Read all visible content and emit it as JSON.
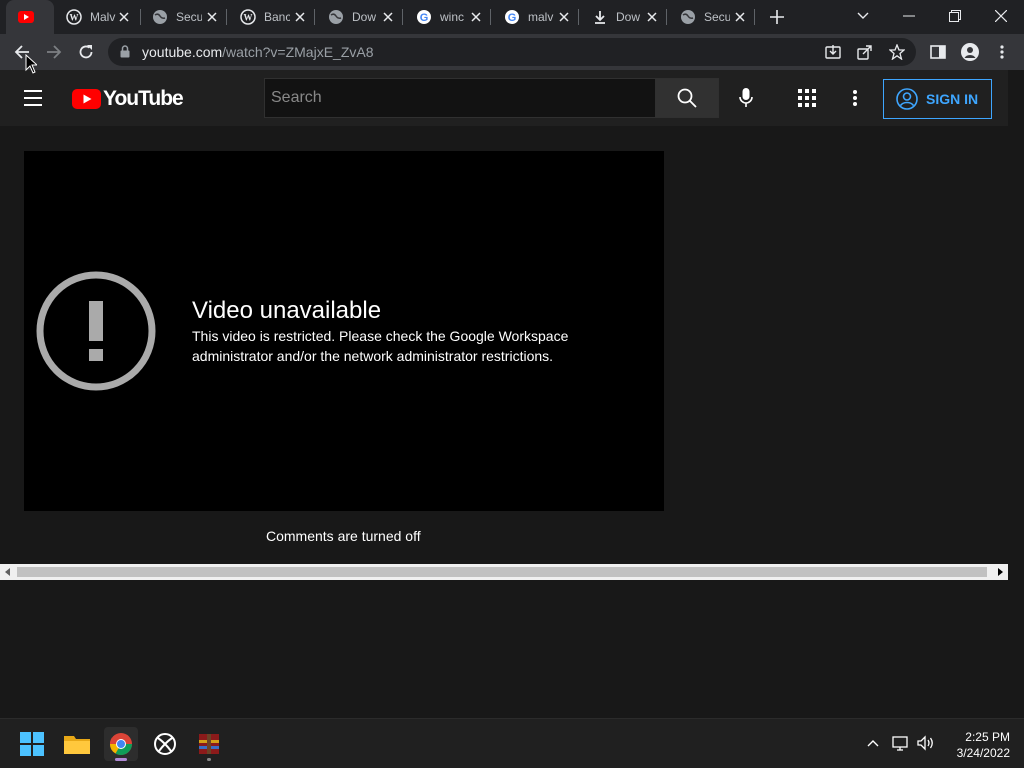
{
  "browser": {
    "tabs": [
      {
        "label": "",
        "favicon": "youtube-icon",
        "active": true
      },
      {
        "label": "Malv",
        "favicon": "wordpress-icon"
      },
      {
        "label": "Secu",
        "favicon": "globe-icon"
      },
      {
        "label": "Banc",
        "favicon": "wordpress-icon"
      },
      {
        "label": "Dow",
        "favicon": "globe-icon"
      },
      {
        "label": "winc",
        "favicon": "google-icon"
      },
      {
        "label": "malv",
        "favicon": "google-icon"
      },
      {
        "label": "Dow",
        "favicon": "download-icon"
      },
      {
        "label": "Secu",
        "favicon": "globe-icon"
      }
    ],
    "url_host": "youtube.com",
    "url_path": "/watch?v=ZMajxE_ZvA8"
  },
  "youtube": {
    "logo_text": "YouTube",
    "search_placeholder": "Search",
    "signin_label": "SIGN IN",
    "error_title": "Video unavailable",
    "error_message": "This video is restricted. Please check the Google Workspace administrator and/or the network administrator restrictions.",
    "comments_text": "Comments are turned off"
  },
  "taskbar": {
    "time": "2:25 PM",
    "date": "3/24/2022"
  },
  "colors": {
    "accent": "#3ea6ff",
    "youtube_red": "#ff0000",
    "background": "#181818"
  }
}
